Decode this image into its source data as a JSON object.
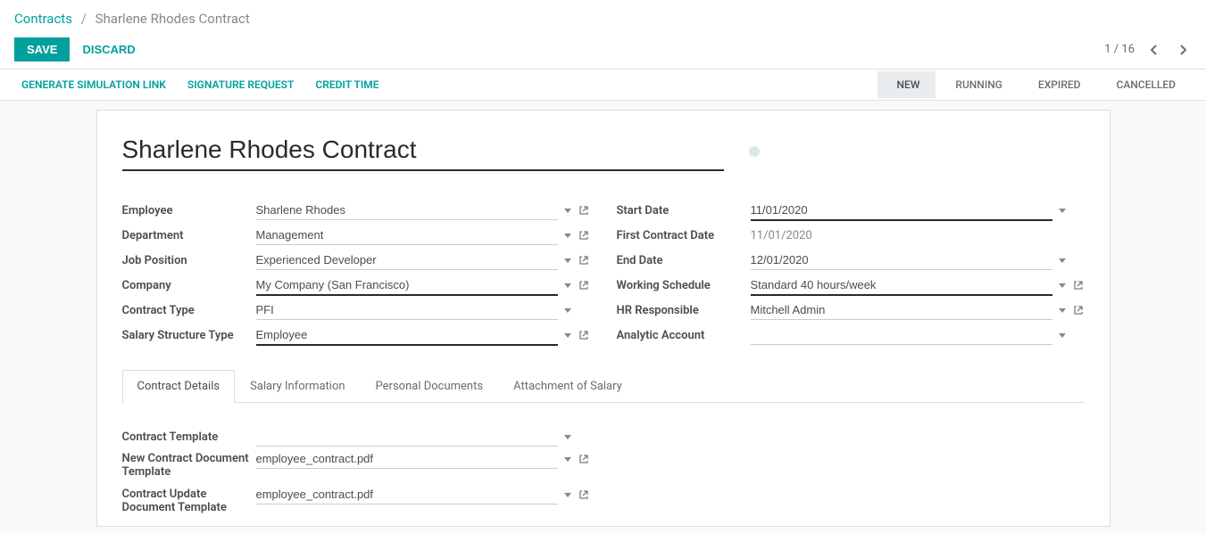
{
  "breadcrumb": {
    "parent": "Contracts",
    "current": "Sharlene Rhodes Contract"
  },
  "buttons": {
    "save": "SAVE",
    "discard": "DISCARD"
  },
  "pager": {
    "text": "1 / 16"
  },
  "statusbar": {
    "actions": {
      "simlink": "GENERATE SIMULATION LINK",
      "sigreq": "SIGNATURE REQUEST",
      "credit": "CREDIT TIME"
    },
    "states": {
      "new": "NEW",
      "running": "RUNNING",
      "expired": "EXPIRED",
      "cancelled": "CANCELLED"
    }
  },
  "title": "Sharlene Rhodes Contract",
  "labels": {
    "employee": "Employee",
    "department": "Department",
    "jobpos": "Job Position",
    "company": "Company",
    "contract_type": "Contract Type",
    "salary_struct": "Salary Structure Type",
    "start_date": "Start Date",
    "first_date": "First Contract Date",
    "end_date": "End Date",
    "work_sched": "Working Schedule",
    "hr_resp": "HR Responsible",
    "analytic": "Analytic Account",
    "contract_template": "Contract Template",
    "new_doc_template": "New Contract Document Template",
    "update_doc_template": "Contract Update Document Template"
  },
  "values": {
    "employee": "Sharlene Rhodes",
    "department": "Management",
    "jobpos": "Experienced Developer",
    "company": "My Company (San Francisco)",
    "contract_type": "PFI",
    "salary_struct": "Employee",
    "start_date": "11/01/2020",
    "first_date": "11/01/2020",
    "end_date": "12/01/2020",
    "work_sched": "Standard 40 hours/week",
    "hr_resp": "Mitchell Admin",
    "analytic": "",
    "contract_template": "",
    "new_doc_template": "employee_contract.pdf",
    "update_doc_template": "employee_contract.pdf"
  },
  "tabs": {
    "details": "Contract Details",
    "salary": "Salary Information",
    "personal": "Personal Documents",
    "attach": "Attachment of Salary"
  }
}
